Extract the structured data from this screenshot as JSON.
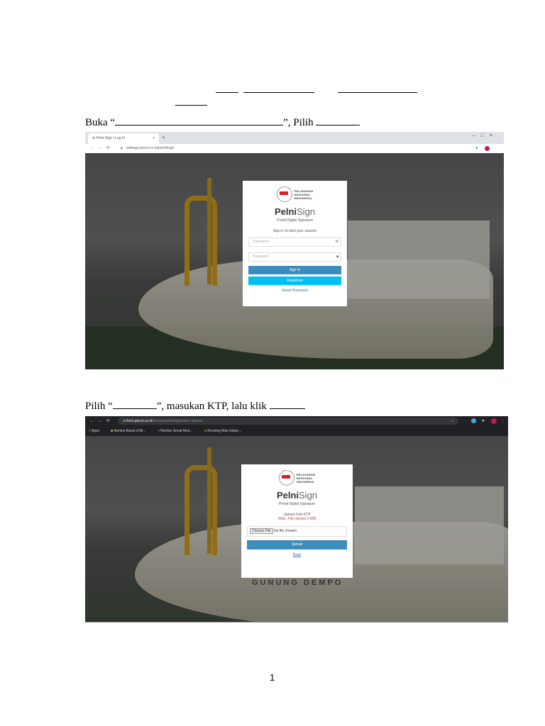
{
  "step1": {
    "text_before": "Buka “",
    "text_mid": "”, Pilih "
  },
  "screenshot1": {
    "tab_title": "Pelni Sign | Log In",
    "tab_close": "×",
    "new_tab": "+",
    "url": "webapp.peruri.co.id/pelni/login",
    "logo_text": [
      "PELAYARAN",
      "NASIONAL",
      "INDONESIA"
    ],
    "brand_bold": "Pelni",
    "brand_light": "Sign",
    "subtitle": "Portal Digital Signature",
    "prompt": "Sign in to start your session",
    "username_placeholder": "Username",
    "password_placeholder": "Password",
    "signin_label": "Sign In",
    "register_label": "Registrasi",
    "reset_label": "Reset Password",
    "colors": {
      "signin": "#3c8dbc",
      "register": "#00c0ef"
    }
  },
  "step2": {
    "text_before": "Pilih “",
    "text_mid": "”, masukan KTP, lalu klik "
  },
  "screenshot2": {
    "url_host": "e-form.peruri.co.id",
    "url_path": "/persai-pelni/registration-upload",
    "bookmarks": [
      "Apps",
      "Nonton Band of Br...",
      "Nonton Serial Mon...",
      "Running Man Episo..."
    ],
    "logo_text": [
      "PELAYARAN",
      "NASIONAL",
      "INDONESIA"
    ],
    "brand_bold": "Pelni",
    "brand_light": "Sign",
    "subtitle": "Portal Digital Signature",
    "upload_title": "Upload Foto KTP",
    "upload_note": "(Max. File Upload 2 MB)",
    "choose_file": "Choose File",
    "no_file": "No file chosen",
    "upload_label": "Upload",
    "cancel_label": "Batal",
    "ship_name": "GUNUNG DEMPO"
  },
  "page_number": "1"
}
